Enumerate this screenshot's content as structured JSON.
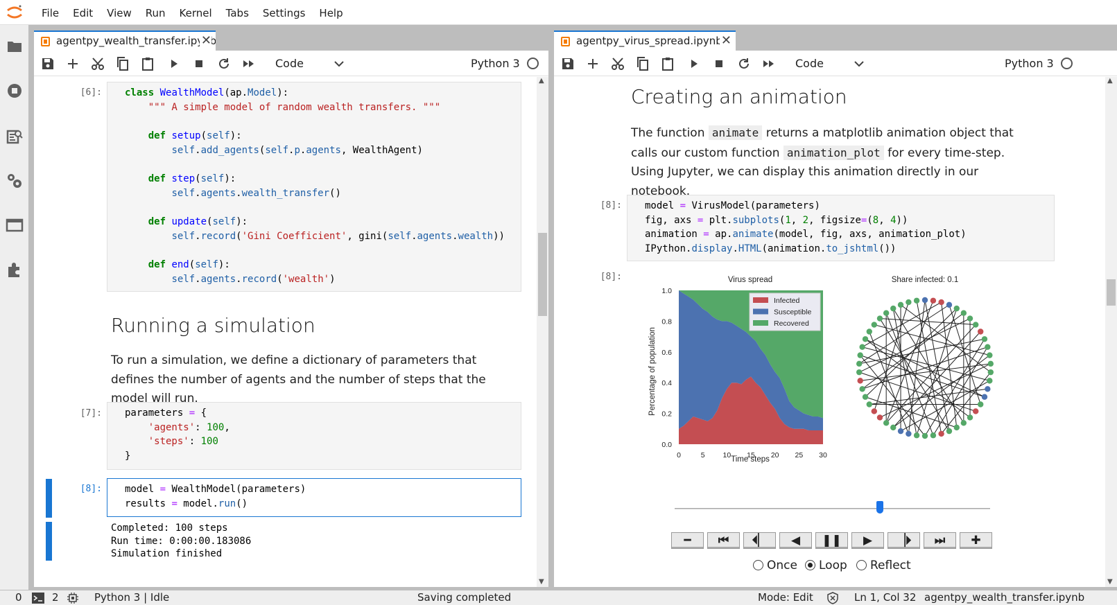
{
  "menu": [
    "File",
    "Edit",
    "View",
    "Run",
    "Kernel",
    "Tabs",
    "Settings",
    "Help"
  ],
  "left_panel": {
    "tab_title": "agentpy_wealth_transfer.ipynb",
    "cell_type": "Code",
    "kernel": "Python 3",
    "prompts": [
      "[6]:",
      "[7]:",
      "[8]:"
    ],
    "heading": "Running a simulation",
    "paragraph": "To run a simulation, we define a dictionary of parameters that defines the number of agents and the number of steps that the model will run.",
    "output": "Completed: 100 steps\nRun time: 0:00:00.183086\nSimulation finished"
  },
  "right_panel": {
    "tab_title": "agentpy_virus_spread.ipynb",
    "cell_type": "Code",
    "kernel": "Python 3",
    "heading": "Creating an animation",
    "para_1": "The function",
    "code_1": "animate",
    "para_2": "returns a matplotlib animation object that calls our custom function",
    "code_2": "animation_plot",
    "para_3": "for every time-step. Using Jupyter, we can display this animation directly in our notebook.",
    "prompts": [
      "[8]:",
      "[8]:"
    ],
    "anim_options": [
      "Once",
      "Loop",
      "Reflect"
    ],
    "anim_selected": "Loop",
    "slider_fraction": 0.65
  },
  "chart_data": [
    {
      "type": "area",
      "title": "Virus spread",
      "xlabel": "Time steps",
      "ylabel": "Percentage of population",
      "x_ticks": [
        "0",
        "5",
        "10",
        "15",
        "20",
        "25",
        "30"
      ],
      "y_ticks": [
        "0.0",
        "0.2",
        "0.4",
        "0.6",
        "0.8",
        "1.0"
      ],
      "xlim": [
        0,
        30
      ],
      "ylim": [
        0,
        1
      ],
      "legend_position": "top-right",
      "x": [
        0,
        1,
        2,
        3,
        4,
        5,
        6,
        7,
        8,
        9,
        10,
        11,
        12,
        13,
        14,
        15,
        16,
        17,
        18,
        19,
        20,
        21,
        22,
        23,
        24,
        25,
        26,
        27,
        28,
        29,
        30
      ],
      "series": [
        {
          "name": "Infected",
          "color": "#c44e52",
          "values": [
            0.1,
            0.12,
            0.15,
            0.18,
            0.17,
            0.16,
            0.15,
            0.17,
            0.22,
            0.3,
            0.36,
            0.4,
            0.4,
            0.39,
            0.42,
            0.44,
            0.4,
            0.37,
            0.32,
            0.27,
            0.23,
            0.17,
            0.13,
            0.11,
            0.1,
            0.1,
            0.1,
            0.09,
            0.09,
            0.09,
            0.09
          ]
        },
        {
          "name": "Susceptible",
          "color": "#4c72b0",
          "values": [
            0.9,
            0.86,
            0.81,
            0.76,
            0.74,
            0.72,
            0.71,
            0.66,
            0.59,
            0.5,
            0.44,
            0.39,
            0.37,
            0.36,
            0.31,
            0.26,
            0.27,
            0.25,
            0.26,
            0.25,
            0.24,
            0.26,
            0.23,
            0.17,
            0.14,
            0.12,
            0.1,
            0.1,
            0.09,
            0.09,
            0.08
          ]
        },
        {
          "name": "Recovered",
          "color": "#55a868",
          "values": [
            0,
            0.02,
            0.04,
            0.06,
            0.09,
            0.12,
            0.14,
            0.17,
            0.19,
            0.2,
            0.2,
            0.21,
            0.23,
            0.25,
            0.27,
            0.3,
            0.33,
            0.38,
            0.42,
            0.48,
            0.53,
            0.57,
            0.64,
            0.72,
            0.76,
            0.78,
            0.8,
            0.81,
            0.82,
            0.82,
            0.83
          ]
        }
      ]
    },
    {
      "type": "network",
      "title": "Share infected: 0.1",
      "node_count": 50,
      "infected_nodes": [
        1,
        2,
        8,
        18,
        23,
        31,
        32,
        36
      ],
      "susceptible_nodes": [
        0,
        3,
        15,
        16,
        27,
        28
      ],
      "edges": [
        [
          0,
          22
        ],
        [
          1,
          30
        ],
        [
          2,
          40
        ],
        [
          3,
          17
        ],
        [
          4,
          26
        ],
        [
          5,
          35
        ],
        [
          6,
          19
        ],
        [
          7,
          44
        ],
        [
          8,
          29
        ],
        [
          9,
          38
        ],
        [
          10,
          24
        ],
        [
          11,
          43
        ],
        [
          12,
          31
        ],
        [
          13,
          47
        ],
        [
          14,
          28
        ],
        [
          15,
          33
        ],
        [
          16,
          41
        ],
        [
          18,
          37
        ],
        [
          20,
          46
        ],
        [
          21,
          34
        ],
        [
          23,
          49
        ],
        [
          25,
          39
        ],
        [
          27,
          42
        ],
        [
          30,
          45
        ],
        [
          32,
          48
        ],
        [
          0,
          27
        ],
        [
          5,
          20
        ],
        [
          9,
          25
        ],
        [
          12,
          36
        ],
        [
          14,
          40
        ],
        [
          17,
          33
        ],
        [
          22,
          44
        ],
        [
          26,
          46
        ],
        [
          35,
          10
        ],
        [
          38,
          3
        ],
        [
          2,
          21
        ],
        [
          7,
          30
        ],
        [
          11,
          29
        ],
        [
          19,
          41
        ],
        [
          24,
          45
        ],
        [
          28,
          47
        ],
        [
          34,
          4
        ],
        [
          6,
          37
        ],
        [
          13,
          23
        ],
        [
          16,
          39
        ]
      ]
    }
  ],
  "status": {
    "terminals": "0",
    "kernels": "2",
    "kernel_status": "Python 3 | Idle",
    "message": "Saving completed",
    "mode": "Mode: Edit",
    "position": "Ln 1, Col 32",
    "file": "agentpy_wealth_transfer.ipynb"
  }
}
